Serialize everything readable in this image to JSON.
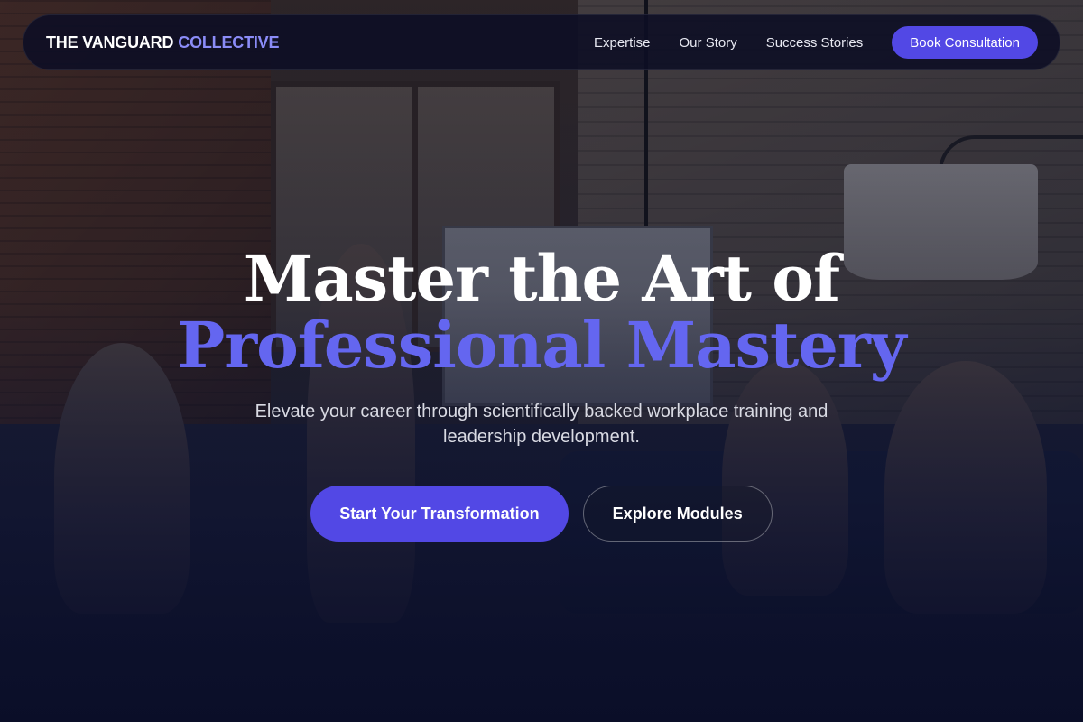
{
  "nav": {
    "brand_primary": "THE VANGUARD",
    "brand_accent": "COLLECTIVE",
    "links": [
      "Expertise",
      "Our Story",
      "Success Stories"
    ],
    "cta_label": "Book Consultation"
  },
  "hero": {
    "title_line1": "Master the Art of",
    "title_line2": "Professional Mastery",
    "subtitle": "Elevate your career through scientifically backed workplace training and leadership development.",
    "primary_button": "Start Your Transformation",
    "secondary_button": "Explore Modules"
  },
  "colors": {
    "accent": "#5248e5",
    "accent_text": "#6466f0",
    "brand_accent": "#8b8cf7",
    "navbar_bg": "#0c0e24"
  }
}
